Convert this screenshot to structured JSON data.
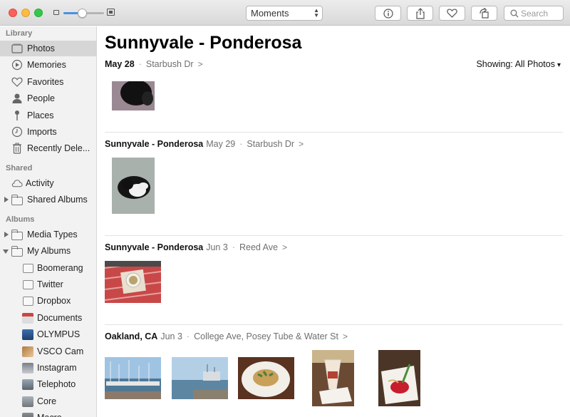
{
  "toolbar": {
    "view_select": "Moments",
    "search_placeholder": "Search",
    "zoom_level": 0.45
  },
  "sidebar": {
    "library_header": "Library",
    "library_items": [
      {
        "label": "Photos",
        "icon": "photos-icon",
        "active": true
      },
      {
        "label": "Memories",
        "icon": "memories-icon"
      },
      {
        "label": "Favorites",
        "icon": "heart-icon"
      },
      {
        "label": "People",
        "icon": "person-icon"
      },
      {
        "label": "Places",
        "icon": "pin-icon"
      },
      {
        "label": "Imports",
        "icon": "clock-icon"
      },
      {
        "label": "Recently Dele...",
        "icon": "trash-icon"
      }
    ],
    "shared_header": "Shared",
    "shared_items": [
      {
        "label": "Activity",
        "icon": "cloud-icon"
      },
      {
        "label": "Shared Albums",
        "icon": "folder-icon"
      }
    ],
    "albums_header": "Albums",
    "album_folders": [
      {
        "label": "Media Types",
        "icon": "folder-icon"
      },
      {
        "label": "My Albums",
        "icon": "folder-icon"
      }
    ],
    "albums": [
      {
        "label": "Boomerang"
      },
      {
        "label": "Twitter"
      },
      {
        "label": "Dropbox"
      },
      {
        "label": "Documents"
      },
      {
        "label": "OLYMPUS"
      },
      {
        "label": "VSCO Cam"
      },
      {
        "label": "Instagram"
      },
      {
        "label": "Telephoto"
      },
      {
        "label": "Core"
      },
      {
        "label": "Macro"
      }
    ]
  },
  "main": {
    "title": "Sunnyvale - Ponderosa",
    "showing_label": "Showing:",
    "showing_value": "All Photos",
    "moments": [
      {
        "title": "May 28",
        "date": "",
        "location": "Starbush Dr"
      },
      {
        "title": "Sunnyvale - Ponderosa",
        "date": "May 29",
        "location": "Starbush Dr"
      },
      {
        "title": "Sunnyvale - Ponderosa",
        "date": "Jun 3",
        "location": "Reed Ave"
      },
      {
        "title": "Oakland, CA",
        "date": "Jun 3",
        "location": "College Ave, Posey Tube & Water St"
      }
    ]
  },
  "colors": {
    "sidebar_bg": "#f2f2f2",
    "sidebar_active": "#d6d6d6",
    "accent": "#4a90e2"
  }
}
